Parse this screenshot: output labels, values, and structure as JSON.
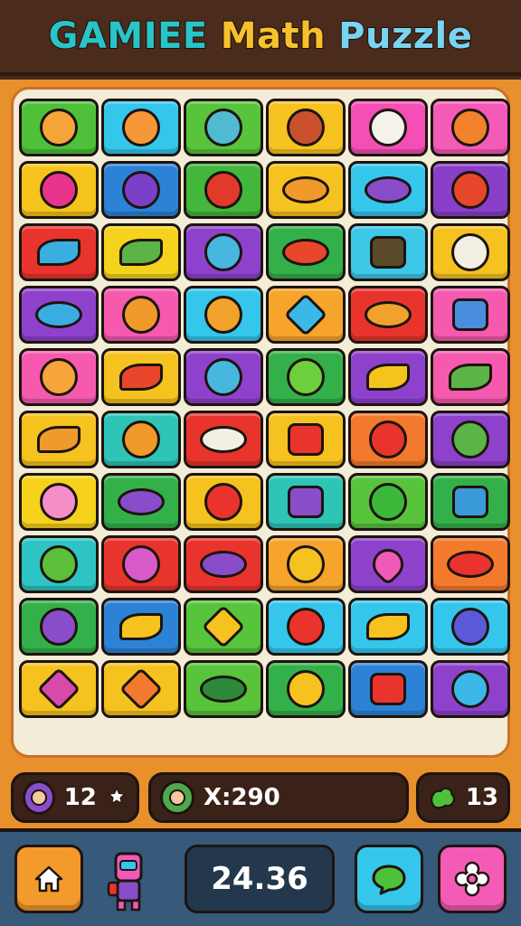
{
  "title": {
    "words": [
      {
        "text": "GAMIEE",
        "color": "#28c4c8"
      },
      {
        "text": "Math",
        "color": "#f6c12c"
      },
      {
        "text": "Puzzle",
        "color": "#7ad3f0"
      }
    ]
  },
  "board": {
    "rows": [
      [
        {
          "bg": "#4ec03a",
          "fg": "#f6a53a",
          "icon": "bear-face-icon",
          "shape": ""
        },
        {
          "bg": "#35c6ec",
          "fg": "#f69838",
          "icon": "smiley-face-icon",
          "shape": ""
        },
        {
          "bg": "#58c43c",
          "fg": "#4fbad0",
          "icon": "zombie-face-icon",
          "shape": ""
        },
        {
          "bg": "#f6c21f",
          "fg": "#c9512e",
          "icon": "monster-face-icon",
          "shape": ""
        },
        {
          "bg": "#f34fb4",
          "fg": "#f5f2ea",
          "icon": "ghost-face-icon",
          "shape": ""
        },
        {
          "bg": "#f45bb7",
          "fg": "#f3822c",
          "icon": "owl-face-icon",
          "shape": ""
        }
      ],
      [
        {
          "bg": "#f5c41c",
          "fg": "#e8348a",
          "icon": "lollipop-icon",
          "shape": ""
        },
        {
          "bg": "#2c82d6",
          "fg": "#7b3fc8",
          "icon": "planet-icon",
          "shape": ""
        },
        {
          "bg": "#43b63c",
          "fg": "#e23a2a",
          "icon": "apple-icon",
          "shape": ""
        },
        {
          "bg": "#f6c21f",
          "fg": "#f09a2c",
          "icon": "football-icon",
          "shape": "shape-oval"
        },
        {
          "bg": "#35c6ec",
          "fg": "#8a4dc9",
          "icon": "candy-icon",
          "shape": "shape-oval"
        },
        {
          "bg": "#8a3fc8",
          "fg": "#e8472c",
          "icon": "berry-icon",
          "shape": ""
        }
      ],
      [
        {
          "bg": "#e8342c",
          "fg": "#3aaee0",
          "icon": "leaf-icon",
          "shape": "shape-leaf"
        },
        {
          "bg": "#f5d21c",
          "fg": "#5cb446",
          "icon": "pea-icon",
          "shape": "shape-leaf"
        },
        {
          "bg": "#8e42cc",
          "fg": "#48b7e0",
          "icon": "cat-face-icon",
          "shape": ""
        },
        {
          "bg": "#34b04a",
          "fg": "#e8472c",
          "icon": "bowl-icon",
          "shape": "shape-oval"
        },
        {
          "bg": "#3cc8e6",
          "fg": "#5a4a2a",
          "icon": "chest-icon",
          "shape": "shape-box"
        },
        {
          "bg": "#f6c21f",
          "fg": "#f2f0e2",
          "icon": "shell-icon",
          "shape": ""
        }
      ],
      [
        {
          "bg": "#8e42cc",
          "fg": "#3aaee0",
          "icon": "ufo-icon",
          "shape": "shape-oval"
        },
        {
          "bg": "#f55aae",
          "fg": "#f09a2c",
          "icon": "fox-face-icon",
          "shape": ""
        },
        {
          "bg": "#35c6ec",
          "fg": "#f0a22c",
          "icon": "dog-face-icon",
          "shape": ""
        },
        {
          "bg": "#f6a42c",
          "fg": "#3cb8e8",
          "icon": "star-icon",
          "shape": "shape-star"
        },
        {
          "bg": "#e8342c",
          "fg": "#f0a22c",
          "icon": "taco-icon",
          "shape": "shape-oval"
        },
        {
          "bg": "#f55aae",
          "fg": "#4a8ee0",
          "icon": "books-icon",
          "shape": "shape-box"
        }
      ],
      [
        {
          "bg": "#f55aae",
          "fg": "#f6a53a",
          "icon": "lion-face-icon",
          "shape": ""
        },
        {
          "bg": "#f6c21f",
          "fg": "#e8472c",
          "icon": "pepper-icon",
          "shape": "shape-leaf"
        },
        {
          "bg": "#8e42cc",
          "fg": "#48b7e0",
          "icon": "blob-face-icon",
          "shape": ""
        },
        {
          "bg": "#34b04a",
          "fg": "#6ccf3c",
          "icon": "slime-face-icon",
          "shape": ""
        },
        {
          "bg": "#8e42cc",
          "fg": "#f5c41c",
          "icon": "lemon-icon",
          "shape": "shape-leaf"
        },
        {
          "bg": "#f55aae",
          "fg": "#5cb446",
          "icon": "green-leaf-icon",
          "shape": "shape-leaf"
        }
      ],
      [
        {
          "bg": "#f6c21f",
          "fg": "#f09a2c",
          "icon": "shell-cone-icon",
          "shape": "shape-leaf"
        },
        {
          "bg": "#2ec4b6",
          "fg": "#f09a2c",
          "icon": "fox-cub-face-icon",
          "shape": ""
        },
        {
          "bg": "#e8342c",
          "fg": "#f2f0e2",
          "icon": "pot-icon",
          "shape": "shape-oval"
        },
        {
          "bg": "#f6c21f",
          "fg": "#e8342c",
          "icon": "dice-icon",
          "shape": "shape-box"
        },
        {
          "bg": "#f37a2c",
          "fg": "#e8342c",
          "icon": "cherry-icon",
          "shape": ""
        },
        {
          "bg": "#8e42cc",
          "fg": "#5cb446",
          "icon": "swirl-icon",
          "shape": ""
        }
      ],
      [
        {
          "bg": "#f6d21c",
          "fg": "#f58ec8",
          "icon": "pig-face-icon",
          "shape": ""
        },
        {
          "bg": "#34b04a",
          "fg": "#8a4dc9",
          "icon": "grape-planet-icon",
          "shape": "shape-oval"
        },
        {
          "bg": "#f6c21f",
          "fg": "#e8342c",
          "icon": "clock-bomb-icon",
          "shape": ""
        },
        {
          "bg": "#2ec4b6",
          "fg": "#8a4dc9",
          "icon": "cube-icon",
          "shape": "shape-box"
        },
        {
          "bg": "#58c43c",
          "fg": "#3cb83a",
          "icon": "green-ball-icon",
          "shape": ""
        },
        {
          "bg": "#34b04a",
          "fg": "#3a9ad8",
          "icon": "book-icon",
          "shape": "shape-box"
        }
      ],
      [
        {
          "bg": "#2ec4c4",
          "fg": "#5cc03a",
          "icon": "frog-face-icon",
          "shape": ""
        },
        {
          "bg": "#e8342c",
          "fg": "#d85ac8",
          "icon": "pink-cat-face-icon",
          "shape": ""
        },
        {
          "bg": "#e8342c",
          "fg": "#8a4dc9",
          "icon": "saucer-icon",
          "shape": "shape-oval"
        },
        {
          "bg": "#f6a42c",
          "fg": "#f6c21f",
          "icon": "sun-face-icon",
          "shape": ""
        },
        {
          "bg": "#8e42cc",
          "fg": "#f05ab8",
          "icon": "heart-icon",
          "shape": "shape-heart"
        },
        {
          "bg": "#f37a2c",
          "fg": "#e8342c",
          "icon": "crab-icon",
          "shape": "shape-oval"
        }
      ],
      [
        {
          "bg": "#34b04a",
          "fg": "#8a4dc9",
          "icon": "grape-lollipop-icon",
          "shape": ""
        },
        {
          "bg": "#2c82d6",
          "fg": "#f6c21f",
          "icon": "corn-icon",
          "shape": "shape-leaf"
        },
        {
          "bg": "#58c43c",
          "fg": "#f6c21f",
          "icon": "gold-star-icon",
          "shape": "shape-star"
        },
        {
          "bg": "#35c6ec",
          "fg": "#e8342c",
          "icon": "red-lollipop-icon",
          "shape": ""
        },
        {
          "bg": "#35c6ec",
          "fg": "#f6c21f",
          "icon": "banana-icon",
          "shape": "shape-leaf"
        },
        {
          "bg": "#35c6ec",
          "fg": "#5a5ad8",
          "icon": "spiral-icon",
          "shape": ""
        }
      ],
      [
        {
          "bg": "#f6c21f",
          "fg": "#d84aa8",
          "icon": "pink-star-icon",
          "shape": "shape-star"
        },
        {
          "bg": "#f6c21f",
          "fg": "#f37a2c",
          "icon": "orange-star-icon",
          "shape": "shape-star"
        },
        {
          "bg": "#58c43c",
          "fg": "#2e8a3a",
          "icon": "turtle-icon",
          "shape": "shape-oval"
        },
        {
          "bg": "#34b04a",
          "fg": "#f6c21f",
          "icon": "bell-icon",
          "shape": ""
        },
        {
          "bg": "#2c82d6",
          "fg": "#e8342c",
          "icon": "crossed-sticks-icon",
          "shape": "shape-box"
        },
        {
          "bg": "#8e42cc",
          "fg": "#3cb8e8",
          "icon": "ring-icon",
          "shape": ""
        }
      ]
    ]
  },
  "status": {
    "moves": {
      "value": "12",
      "icon": "star-badge-icon",
      "avatar_color": "#8a4dc9"
    },
    "score": {
      "text": "X:290",
      "avatar_color": "#4fa84a"
    },
    "bonus": {
      "value": "13",
      "icon": "green-blob-icon",
      "color": "#4ec03a"
    }
  },
  "bottom": {
    "home": {
      "icon": "home-icon",
      "color": "#f39a2c"
    },
    "character": {
      "icon": "robot-character-icon"
    },
    "timer": "24.36",
    "chat": {
      "icon": "speech-bubble-icon",
      "color": "#35c6ec"
    },
    "settings": {
      "icon": "flower-gear-icon",
      "color": "#f45bb7"
    }
  }
}
